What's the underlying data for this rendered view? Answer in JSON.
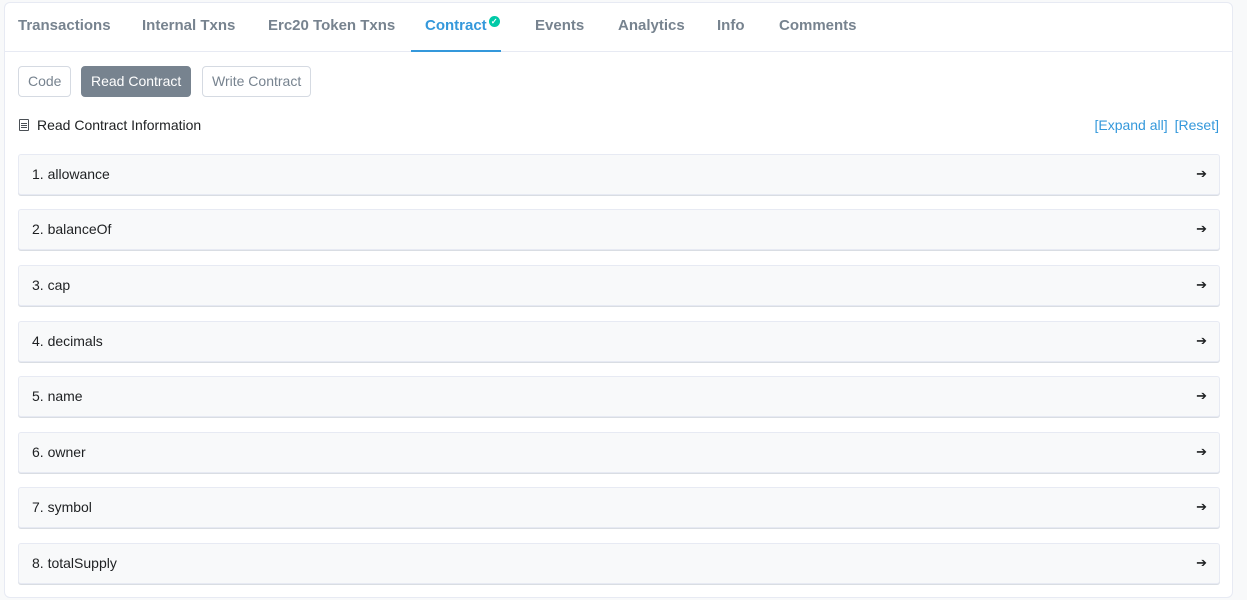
{
  "tabs": [
    {
      "label": "Transactions"
    },
    {
      "label": "Internal Txns"
    },
    {
      "label": "Erc20 Token Txns"
    },
    {
      "label": "Contract"
    },
    {
      "label": "Events"
    },
    {
      "label": "Analytics"
    },
    {
      "label": "Info"
    },
    {
      "label": "Comments"
    }
  ],
  "active_tab": "Contract",
  "contract_subtabs": [
    {
      "label": "Code"
    },
    {
      "label": "Read Contract"
    },
    {
      "label": "Write Contract"
    }
  ],
  "active_subtab": "Read Contract",
  "section": {
    "title": "Read Contract Information",
    "expand_all": "[Expand all]",
    "reset": "[Reset]"
  },
  "functions": [
    {
      "label": "1. allowance"
    },
    {
      "label": "2. balanceOf"
    },
    {
      "label": "3. cap"
    },
    {
      "label": "4. decimals"
    },
    {
      "label": "5. name"
    },
    {
      "label": "6. owner"
    },
    {
      "label": "7. symbol"
    },
    {
      "label": "8. totalSupply"
    }
  ],
  "colors": {
    "accent": "#3498db",
    "verified": "#00c9a7",
    "active_button": "#77838f"
  },
  "icons": {
    "verified": "check-circle-icon",
    "section": "document-icon",
    "row_action": "arrow-right-icon"
  }
}
